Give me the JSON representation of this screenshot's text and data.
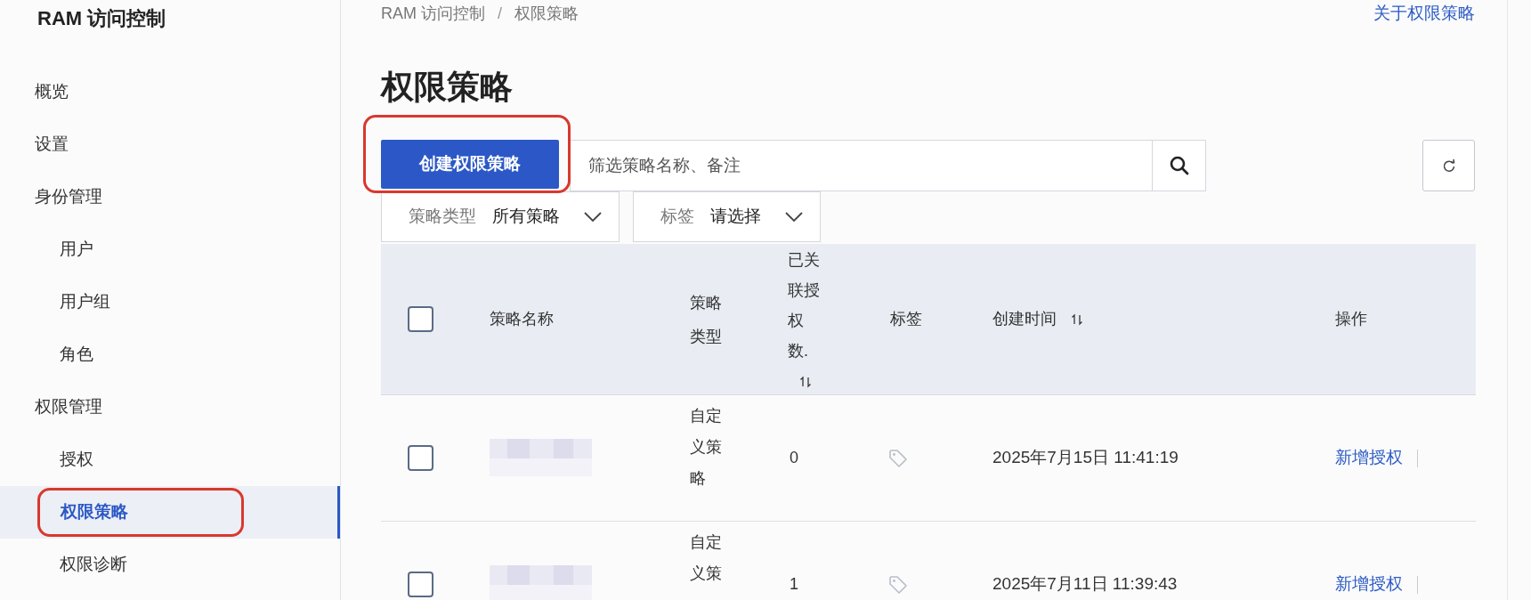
{
  "sidebar": {
    "title": "RAM 访问控制",
    "items": [
      {
        "label": "概览",
        "selected": false
      },
      {
        "label": "设置",
        "selected": false
      },
      {
        "label": "身份管理",
        "selected": false,
        "children": [
          {
            "label": "用户",
            "selected": false
          },
          {
            "label": "用户组",
            "selected": false
          },
          {
            "label": "角色",
            "selected": false
          }
        ]
      },
      {
        "label": "权限管理",
        "selected": false,
        "children": [
          {
            "label": "授权",
            "selected": false
          },
          {
            "label": "权限策略",
            "selected": true
          },
          {
            "label": "权限诊断",
            "selected": false
          }
        ]
      }
    ]
  },
  "breadcrumb": {
    "items": [
      "RAM 访问控制",
      "权限策略"
    ],
    "separator": "/"
  },
  "help_link": "关于权限策略",
  "page_title": "权限策略",
  "create_button": "创建权限策略",
  "search": {
    "placeholder": "筛选策略名称、备注"
  },
  "filters": [
    {
      "label": "策略类型",
      "value": "所有策略"
    },
    {
      "label": "标签",
      "value": "请选择"
    }
  ],
  "table": {
    "columns": [
      {
        "kind": "checkbox",
        "checked": false
      },
      {
        "kind": "text",
        "label": "策略名称"
      },
      {
        "kind": "text",
        "label": "策略类型"
      },
      {
        "kind": "sortable_narrow",
        "label": "已关联授权数."
      },
      {
        "kind": "text",
        "label": "标签"
      },
      {
        "kind": "sortable",
        "label": "创建时间"
      },
      {
        "kind": "text",
        "label": "操作"
      }
    ],
    "rows": [
      {
        "checked": false,
        "type": "自定义策略",
        "count": "0",
        "created": "2025年7月15日 11:41:19",
        "action": "新增授权"
      },
      {
        "checked": false,
        "type": "自定义策",
        "count": "1",
        "created": "2025年7月11日 11:39:43",
        "action": "新增授权"
      }
    ]
  }
}
